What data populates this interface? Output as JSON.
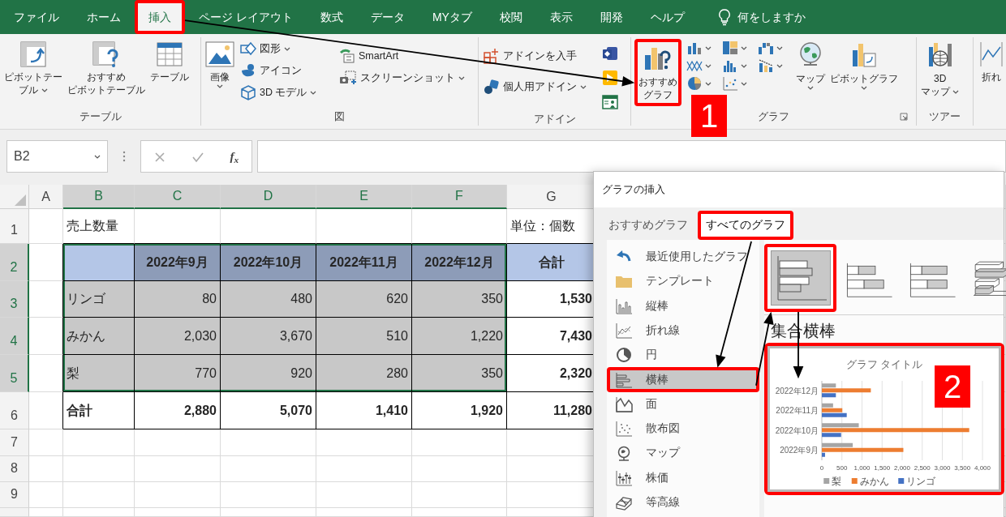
{
  "menu_tabs": [
    {
      "label": "ファイル",
      "selected": false,
      "highlighted": false
    },
    {
      "label": "ホーム",
      "selected": false,
      "highlighted": false
    },
    {
      "label": "挿入",
      "selected": true,
      "highlighted": true
    },
    {
      "label": "ページ レイアウト",
      "selected": false,
      "highlighted": false
    },
    {
      "label": "数式",
      "selected": false,
      "highlighted": false
    },
    {
      "label": "データ",
      "selected": false,
      "highlighted": false
    },
    {
      "label": "MYタブ",
      "selected": false,
      "highlighted": false
    },
    {
      "label": "校閲",
      "selected": false,
      "highlighted": false
    },
    {
      "label": "表示",
      "selected": false,
      "highlighted": false
    },
    {
      "label": "開発",
      "selected": false,
      "highlighted": false
    },
    {
      "label": "ヘルプ",
      "selected": false,
      "highlighted": false
    }
  ],
  "tell_me": "何をしますか",
  "ribbon": {
    "groups": [
      {
        "label": "テーブル",
        "items": [
          {
            "lines": [
              "ピボットテー",
              "ブル"
            ],
            "highlighted": false
          },
          {
            "lines": [
              "おすすめ",
              "ピボットテーブル"
            ],
            "highlighted": false
          },
          {
            "lines": [
              "テーブル"
            ],
            "highlighted": false
          }
        ]
      },
      {
        "label": "図",
        "items": [
          {
            "lines": [
              "画像"
            ],
            "highlighted": false
          },
          {
            "lines": [
              "図形"
            ],
            "highlighted": false
          },
          {
            "lines": [
              "アイコン"
            ],
            "highlighted": false
          },
          {
            "lines": [
              "3D モデル"
            ],
            "highlighted": false
          },
          {
            "lines": [
              "SmartArt"
            ],
            "highlighted": false
          },
          {
            "lines": [
              "スクリーンショット"
            ],
            "highlighted": false
          }
        ]
      },
      {
        "label": "アドイン",
        "items": [
          {
            "lines": [
              "アドインを入手"
            ],
            "highlighted": false
          },
          {
            "lines": [
              "個人用アドイン"
            ],
            "highlighted": false
          }
        ]
      },
      {
        "label": "グラフ",
        "items": [
          {
            "lines": [
              "おすすめ",
              "グラフ"
            ],
            "highlighted": true
          },
          {
            "lines": [
              "マップ"
            ],
            "highlighted": false
          },
          {
            "lines": [
              "ピボットグラフ"
            ],
            "highlighted": false
          }
        ]
      },
      {
        "label": "ツアー",
        "items": [
          {
            "lines": [
              "3D",
              "マップ"
            ],
            "highlighted": false
          }
        ]
      },
      {
        "items": [
          {
            "lines": [
              "折れ"
            ],
            "highlighted": false
          }
        ]
      }
    ]
  },
  "step_markers": [
    "1",
    "2"
  ],
  "formula_bar": {
    "name_box": "B2",
    "function_label": "f$_{x}$"
  },
  "sheet": {
    "columns": [
      {
        "label": "A",
        "selected": false
      },
      {
        "label": "B",
        "selected": true
      },
      {
        "label": "C",
        "selected": true
      },
      {
        "label": "D",
        "selected": true
      },
      {
        "label": "E",
        "selected": true
      },
      {
        "label": "F",
        "selected": true
      },
      {
        "label": "G",
        "selected": false
      }
    ],
    "rows": [
      {
        "label": "1",
        "selected": false,
        "cells": [
          null,
          {
            "text": "売上数量",
            "kind": "text"
          },
          null,
          null,
          null,
          null,
          {
            "text": "単位：個数",
            "kind": "text"
          }
        ]
      },
      {
        "label": "2",
        "selected": true,
        "cells": [
          null,
          {
            "kind": "text",
            "filled": true,
            "framed": true,
            "active": true
          },
          {
            "text": "2022年9月",
            "kind": "header",
            "bold": true,
            "filled": true,
            "framed": true
          },
          {
            "text": "2022年10月",
            "kind": "header",
            "bold": true,
            "filled": true,
            "framed": true
          },
          {
            "text": "2022年11月",
            "kind": "header",
            "bold": true,
            "filled": true,
            "framed": true
          },
          {
            "text": "2022年12月",
            "kind": "header",
            "bold": true,
            "filled": true,
            "framed": true
          },
          {
            "text": "合計",
            "kind": "header",
            "bold": true,
            "filled": true,
            "framed": true
          }
        ]
      },
      {
        "label": "3",
        "selected": true,
        "cells": [
          null,
          {
            "text": "リンゴ",
            "kind": "text",
            "framed": true
          },
          {
            "text": "80",
            "kind": "number",
            "framed": true
          },
          {
            "text": "480",
            "kind": "number",
            "framed": true
          },
          {
            "text": "620",
            "kind": "number",
            "framed": true
          },
          {
            "text": "350",
            "kind": "number",
            "framed": true
          },
          {
            "text": "1,530",
            "kind": "number",
            "bold": true,
            "framed": true
          }
        ]
      },
      {
        "label": "4",
        "selected": true,
        "cells": [
          null,
          {
            "text": "みかん",
            "kind": "text",
            "framed": true
          },
          {
            "text": "2,030",
            "kind": "number",
            "framed": true
          },
          {
            "text": "3,670",
            "kind": "number",
            "framed": true
          },
          {
            "text": "510",
            "kind": "number",
            "framed": true
          },
          {
            "text": "1,220",
            "kind": "number",
            "framed": true
          },
          {
            "text": "7,430",
            "kind": "number",
            "bold": true,
            "framed": true
          }
        ]
      },
      {
        "label": "5",
        "selected": true,
        "cells": [
          null,
          {
            "text": "梨",
            "kind": "text",
            "framed": true
          },
          {
            "text": "770",
            "kind": "number",
            "framed": true
          },
          {
            "text": "920",
            "kind": "number",
            "framed": true
          },
          {
            "text": "280",
            "kind": "number",
            "framed": true
          },
          {
            "text": "350",
            "kind": "number",
            "framed": true
          },
          {
            "text": "2,320",
            "kind": "number",
            "bold": true,
            "framed": true
          }
        ]
      },
      {
        "label": "6",
        "selected": false,
        "cells": [
          null,
          {
            "text": "合計",
            "kind": "text",
            "bold": true,
            "framed": true
          },
          {
            "text": "2,880",
            "kind": "number",
            "bold": true,
            "framed": true
          },
          {
            "text": "5,070",
            "kind": "number",
            "bold": true,
            "framed": true
          },
          {
            "text": "1,410",
            "kind": "number",
            "bold": true,
            "framed": true
          },
          {
            "text": "1,920",
            "kind": "number",
            "bold": true,
            "framed": true
          },
          {
            "text": "11,280",
            "kind": "number",
            "bold": true,
            "framed": true
          }
        ]
      },
      {
        "label": "7",
        "selected": false
      },
      {
        "label": "8",
        "selected": false
      },
      {
        "label": "9",
        "selected": false
      }
    ]
  },
  "dialog": {
    "title": "グラフの挿入",
    "tabs": [
      {
        "label": "おすすめグラフ",
        "selected": false,
        "highlighted": false
      },
      {
        "label": "すべてのグラフ",
        "selected": true,
        "highlighted": true
      }
    ],
    "categories": [
      {
        "label": "最近使用したグラフ",
        "selected": false,
        "highlighted": false
      },
      {
        "label": "テンプレート",
        "selected": false,
        "highlighted": false
      },
      {
        "label": "縦棒",
        "selected": false,
        "highlighted": false
      },
      {
        "label": "折れ線",
        "selected": false,
        "highlighted": false
      },
      {
        "label": "円",
        "selected": false,
        "highlighted": false
      },
      {
        "label": "横棒",
        "selected": true,
        "highlighted": true
      },
      {
        "label": "面",
        "selected": false,
        "highlighted": false
      },
      {
        "label": "散布図",
        "selected": false,
        "highlighted": false
      },
      {
        "label": "マップ",
        "selected": false,
        "highlighted": false
      },
      {
        "label": "株価",
        "selected": false,
        "highlighted": false
      },
      {
        "label": "等高線",
        "selected": false,
        "highlighted": false
      }
    ],
    "subtypes": [
      {
        "selected": true,
        "highlighted": true
      },
      {
        "selected": false,
        "highlighted": false
      },
      {
        "selected": false,
        "highlighted": false
      },
      {
        "selected": false,
        "highlighted": false
      }
    ],
    "subtype_title": "集合横棒",
    "preview": {
      "highlighted": true,
      "chart_data": {
        "type": "bar",
        "orientation": "horizontal",
        "title": "グラフ タイトル",
        "categories": [
          "2022年12月",
          "2022年11月",
          "2022年10月",
          "2022年9月"
        ],
        "series": [
          {
            "name": "梨",
            "color": "#a5a5a5",
            "values": [
              350,
              280,
              920,
              770
            ]
          },
          {
            "name": "みかん",
            "color": "#ed7d31",
            "values": [
              1220,
              510,
              3670,
              2030
            ]
          },
          {
            "name": "リンゴ",
            "color": "#4472c4",
            "values": [
              350,
              620,
              480,
              80
            ]
          }
        ],
        "legend": "bottom",
        "grid": true,
        "xlim": [
          0,
          4000
        ],
        "xticks": [
          {
            "value": 0,
            "label": "0"
          },
          {
            "value": 500,
            "label": "500"
          },
          {
            "value": 1000,
            "label": "1,000"
          },
          {
            "value": 1500,
            "label": "1,500"
          },
          {
            "value": 2000,
            "label": "2,000"
          },
          {
            "value": 2500,
            "label": "2,500"
          },
          {
            "value": 3000,
            "label": "3,000"
          },
          {
            "value": 3500,
            "label": "3,500"
          },
          {
            "value": 4000,
            "label": "4,000"
          }
        ]
      }
    }
  }
}
